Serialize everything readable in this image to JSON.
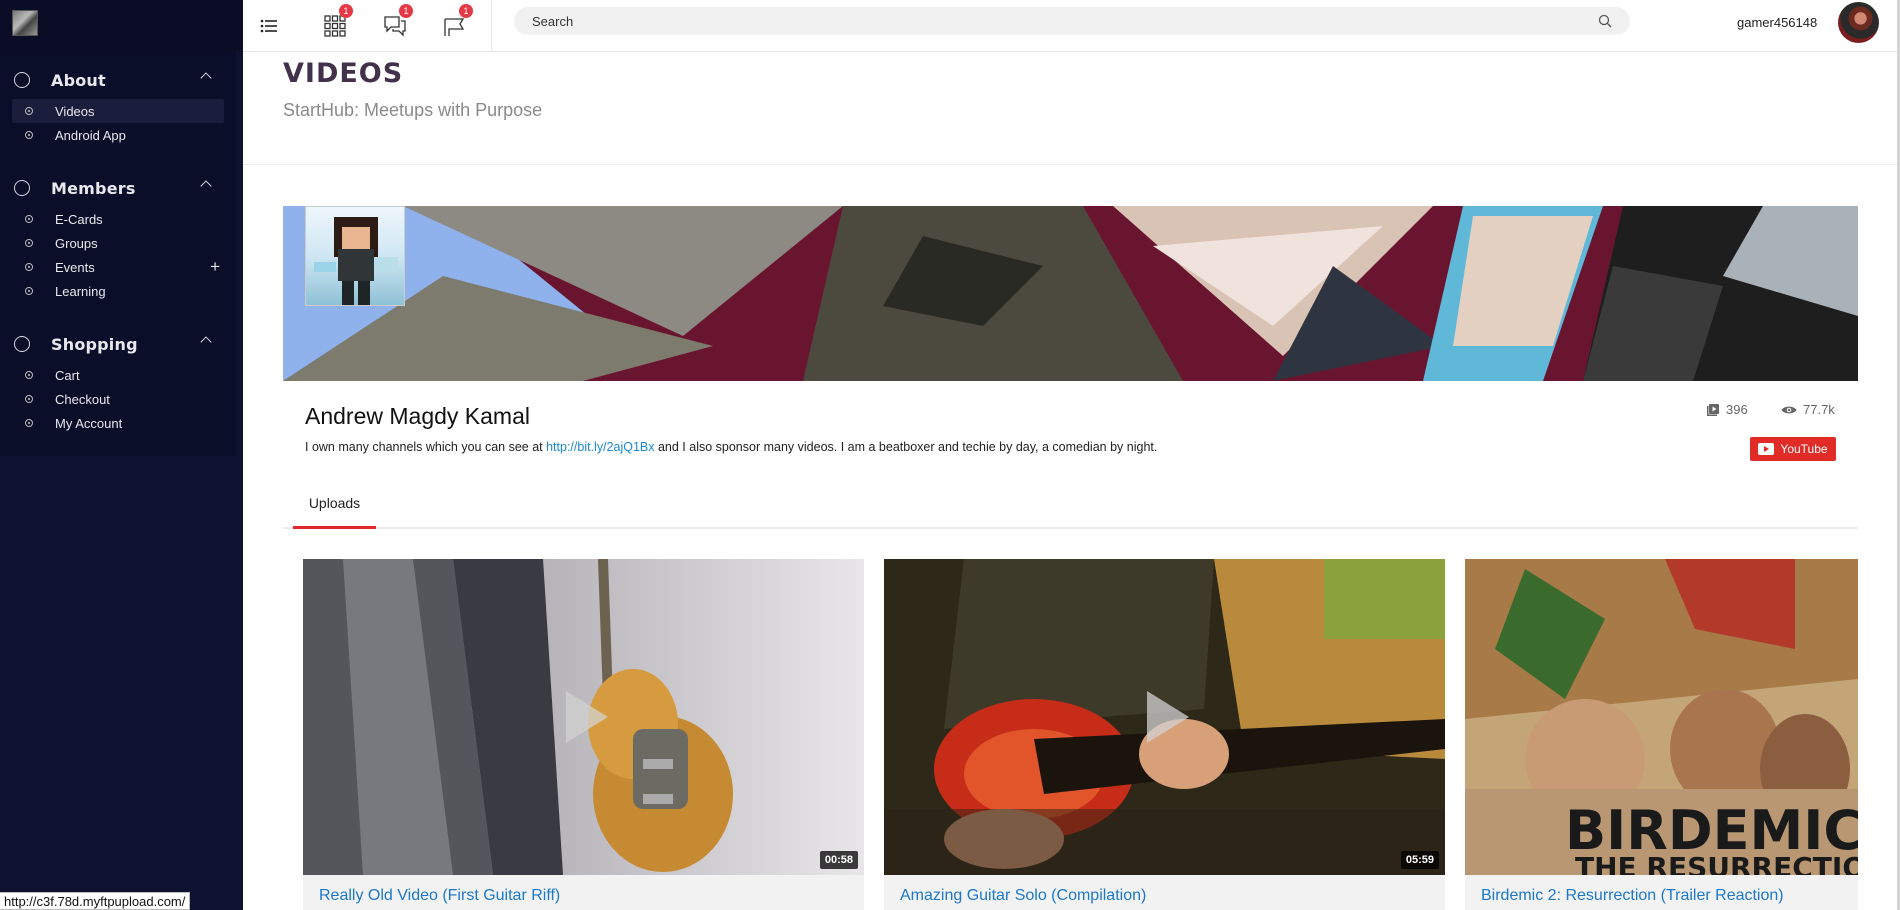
{
  "app": {
    "logo": "app-logo"
  },
  "sidebar": {
    "groups": [
      {
        "label": "About",
        "items": [
          {
            "label": "Videos",
            "active": true
          },
          {
            "label": "Android App"
          }
        ]
      },
      {
        "label": "Members",
        "items": [
          {
            "label": "E-Cards"
          },
          {
            "label": "Groups"
          },
          {
            "label": "Events",
            "expandable": true
          },
          {
            "label": "Learning"
          }
        ]
      },
      {
        "label": "Shopping",
        "items": [
          {
            "label": "Cart"
          },
          {
            "label": "Checkout"
          },
          {
            "label": "My Account"
          }
        ]
      }
    ],
    "expand_symbol": "+"
  },
  "topbar": {
    "badges": {
      "apps": "1",
      "messages": "1",
      "announcements": "1"
    },
    "search_placeholder": "Search",
    "username": "gamer456148"
  },
  "page": {
    "title": "VIDEOS",
    "subtitle": "StartHub: Meetups with Purpose"
  },
  "channel": {
    "name": "Andrew Magdy Kamal",
    "desc_before": "I own many channels which you can see at ",
    "desc_link": "http://bit.ly/2ajQ1Bx",
    "desc_after": " and I also sponsor many videos. I am a beatboxer and techie by day, a comedian by night.",
    "video_count": "396",
    "view_count": "77.7k",
    "youtube_label": "YouTube"
  },
  "tabs": {
    "uploads": "Uploads"
  },
  "videos": [
    {
      "title": "Really Old Video (First Guitar Riff)",
      "duration": "00:58"
    },
    {
      "title": "Amazing Guitar Solo (Compilation)",
      "duration": "05:59"
    },
    {
      "title": "Birdemic 2: Resurrection (Trailer Reaction)",
      "duration": "",
      "thumb_text_1": "BIRDEMIC",
      "thumb_text_2": "THE RESURRECTION"
    }
  ],
  "statusbar": {
    "url": "http://c3f.78d.myftpupload.com/"
  },
  "colors": {
    "sidebar": "#0e1130",
    "accent_red": "#e0282b",
    "link_blue": "#1c78c9",
    "title_purple": "#43304a"
  }
}
